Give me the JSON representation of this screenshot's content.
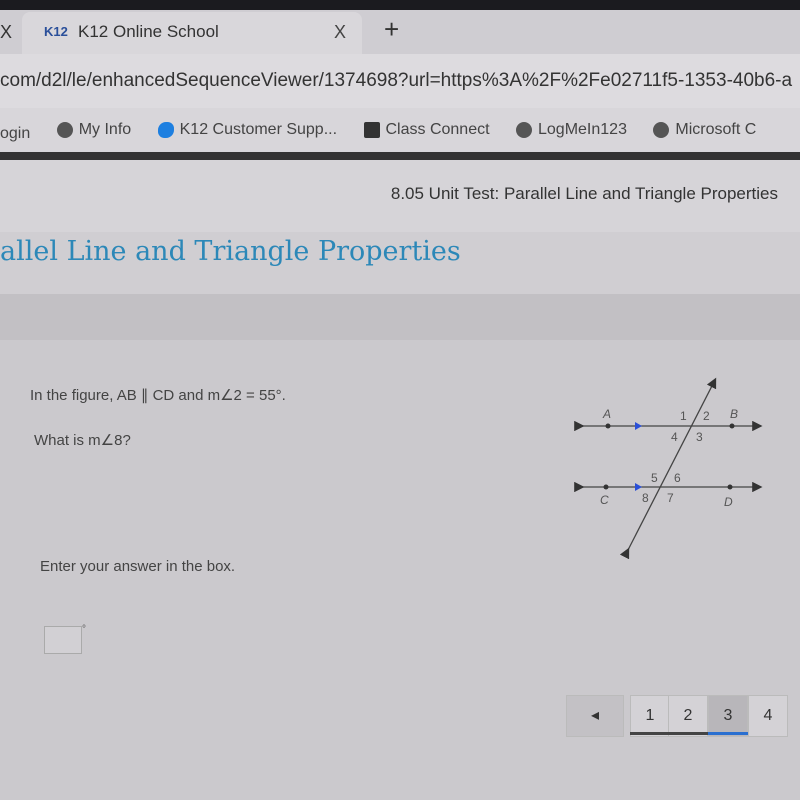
{
  "browser": {
    "prev_tab_close": "X",
    "tab_logo": "K12",
    "tab_title": "K12 Online School",
    "tab_close": "X",
    "new_tab": "+",
    "url": "com/d2l/le/enhancedSequenceViewer/1374698?url=https%3A%2F%2Fe02711f5-1353-40b6-a",
    "bookmarks": [
      "ogin",
      "My Info",
      "K12 Customer Supp...",
      "Class Connect",
      "LogMeIn123",
      "Microsoft C"
    ]
  },
  "header": {
    "test_title": "8.05 Unit Test: Parallel Line and Triangle Properties",
    "page_title": "allel Line and Triangle Properties"
  },
  "question": {
    "prompt": "In the figure, AB ∥ CD and m∠2 = 55°.",
    "ask": "What is m∠8?",
    "instruction": "Enter your answer in the box.",
    "answer": "",
    "degree": "°"
  },
  "figure": {
    "points": [
      "A",
      "B",
      "C",
      "D"
    ],
    "angles": [
      "1",
      "2",
      "3",
      "4",
      "5",
      "6",
      "7",
      "8"
    ],
    "arrow_color": "#2a4fd8"
  },
  "pagination": {
    "prev": "◂",
    "pages": [
      "1",
      "2",
      "3",
      "4"
    ],
    "current": "3",
    "accent": "#2a6fd0"
  }
}
